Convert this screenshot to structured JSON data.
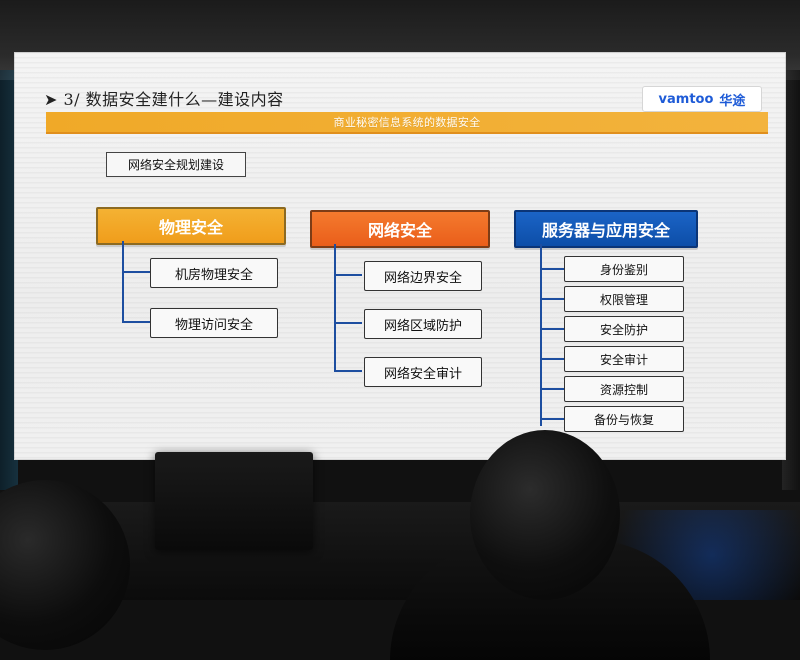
{
  "slide": {
    "title": "➤ 3/  数据安全建什么—建设内容",
    "logo_en": "vamtoo",
    "logo_cn": "华途",
    "banner_text": "商业秘密信息系统的数据安全",
    "section_label": "网络安全规划建设"
  },
  "categories": [
    {
      "label": "物理安全",
      "color": "#F2A22A",
      "items": [
        "机房物理安全",
        "物理访问安全"
      ]
    },
    {
      "label": "网络安全",
      "color": "#EF6A22",
      "items": [
        "网络边界安全",
        "网络区域防护",
        "网络安全审计"
      ]
    },
    {
      "label": "服务器与应用安全",
      "color": "#145CBE",
      "items": [
        "身份鉴别",
        "权限管理",
        "安全防护",
        "安全审计",
        "资源控制",
        "备份与恢复"
      ]
    }
  ]
}
